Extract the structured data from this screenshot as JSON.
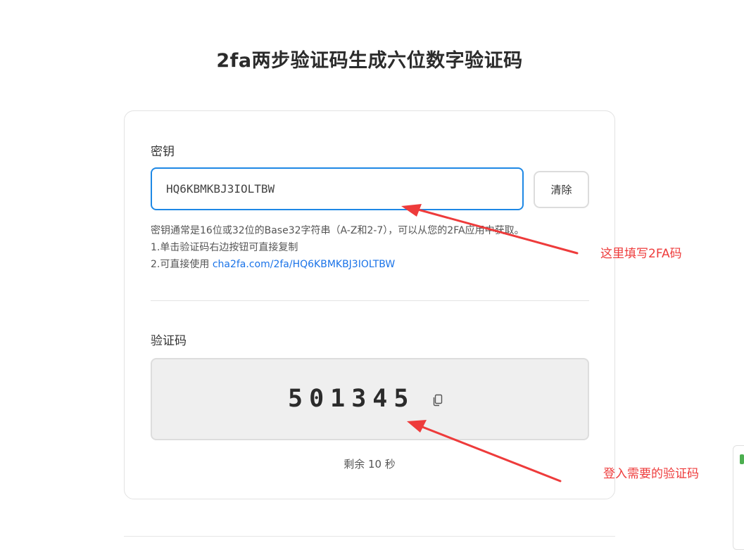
{
  "page": {
    "title": "2fa两步验证码生成六位数字验证码"
  },
  "secret_section": {
    "label": "密钥",
    "input_value": "HQ6KBMKBJ3IOLTBW",
    "clear_button": "清除",
    "help_line1": "密钥通常是16位或32位的Base32字符串（A-Z和2-7），可以从您的2FA应用中获取。",
    "help_line2": "1.单击验证码右边按钮可直接复制",
    "help_line3_prefix": "2.可直接使用 ",
    "help_link": "cha2fa.com/2fa/HQ6KBMKBJ3IOLTBW"
  },
  "code_section": {
    "label": "验证码",
    "code": "501345",
    "copy_icon": "copy-icon",
    "countdown": "剩余 10 秒"
  },
  "annotations": {
    "top_note": "这里填写2FA码",
    "bottom_note": "登入需要的验证码",
    "color": "#ee3b3b"
  },
  "colors": {
    "accent": "#1e88e5",
    "link": "#1a73e8",
    "code_box_bg": "#efefef"
  }
}
